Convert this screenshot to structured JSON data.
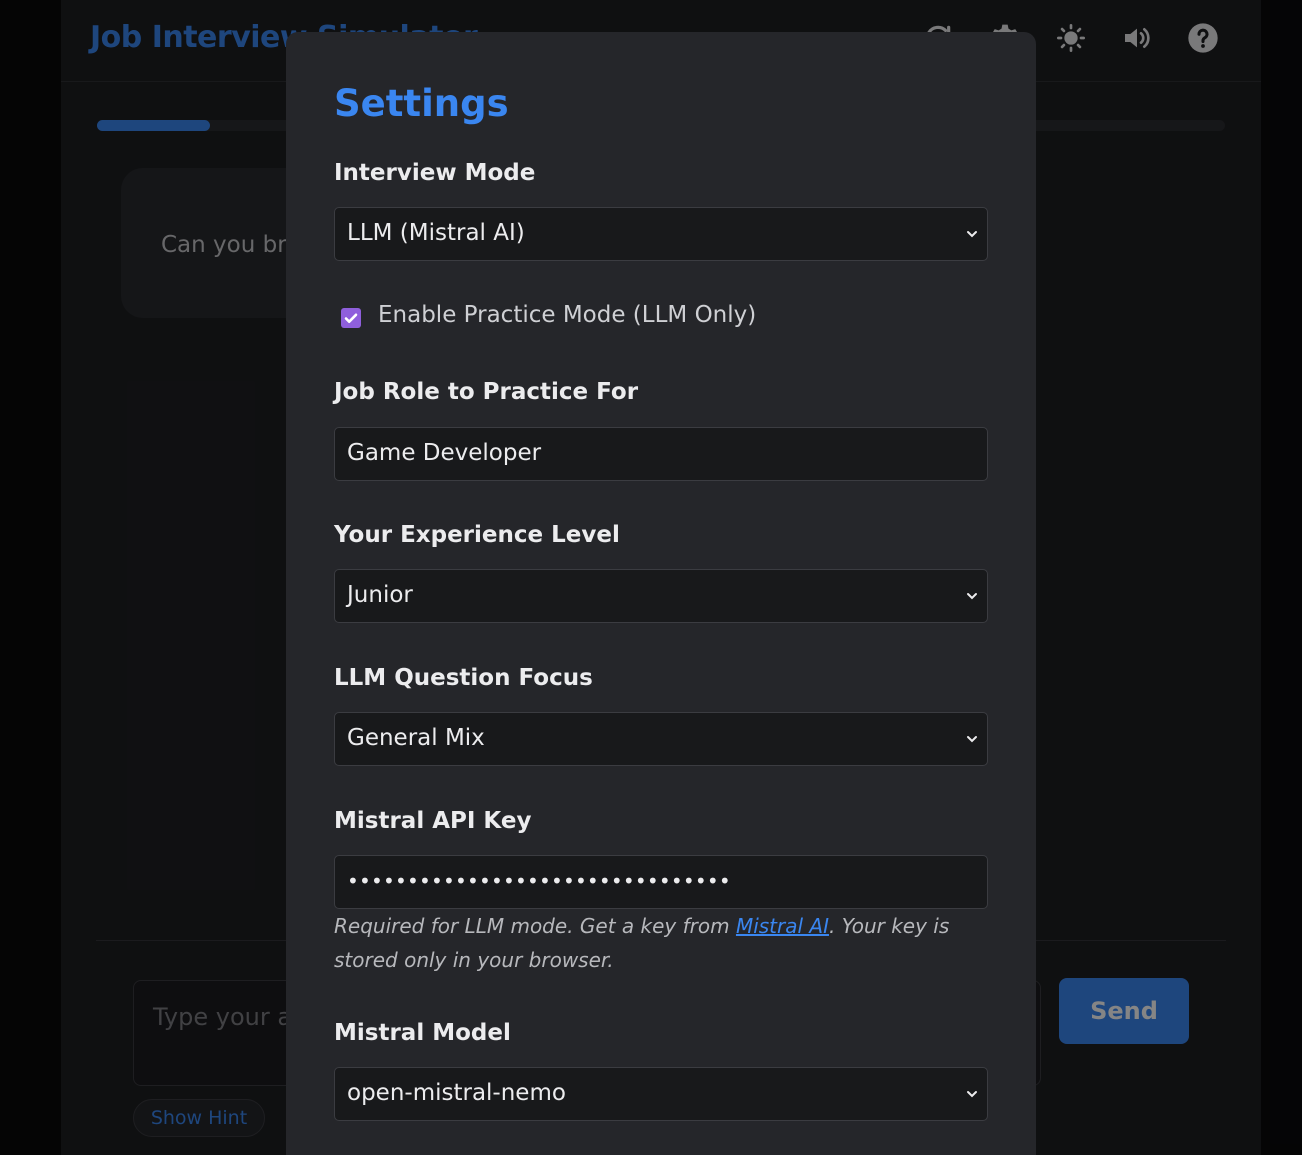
{
  "app": {
    "title": "Job Interview Simulator",
    "progress_fraction": 0.1,
    "question_text": "Can you briefly introduce yourself?",
    "answer_placeholder": "Type your answer here...",
    "send_label": "Send",
    "hint_label": "Show Hint",
    "header_icons": [
      "refresh-icon",
      "gear-icon",
      "sun-icon",
      "speaker-icon",
      "help-icon"
    ]
  },
  "settings": {
    "title": "Settings",
    "interview_mode": {
      "label": "Interview Mode",
      "value": "LLM (Mistral AI)"
    },
    "practice_mode": {
      "label": "Enable Practice Mode (LLM Only)",
      "checked": true
    },
    "job_role": {
      "label": "Job Role to Practice For",
      "value": "Game Developer"
    },
    "experience_level": {
      "label": "Your Experience Level",
      "value": "Junior"
    },
    "question_focus": {
      "label": "LLM Question Focus",
      "value": "General Mix"
    },
    "api_key": {
      "label": "Mistral API Key",
      "value_masked": "••••••••••••••••••••••••••••••••",
      "help_before": "Required for LLM mode. Get a key from ",
      "help_link": "Mistral AI",
      "help_after": ". Your key is stored only in your browser."
    },
    "model": {
      "label": "Mistral Model",
      "value": "open-mistral-nemo"
    }
  },
  "colors": {
    "accent": "#3a86f0",
    "checkbox": "#8f5fdc",
    "modal_bg": "#25262a",
    "field_bg": "#18191b"
  }
}
